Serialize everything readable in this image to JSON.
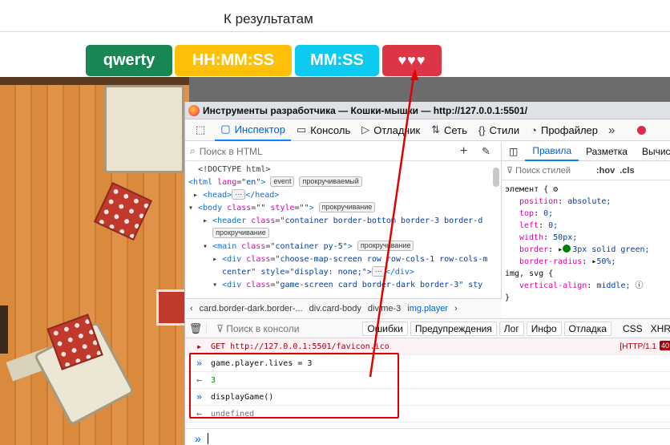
{
  "top_link": "К результатам",
  "badges": {
    "name": "qwerty",
    "time": "HH:MM:SS",
    "short_time": "MM:SS",
    "lives": "♥♥♥"
  },
  "devtools": {
    "window_title": "Инструменты разработчика — Кошки-мышки — http://127.0.0.1:5501/",
    "tabs": [
      "Инспектор",
      "Консоль",
      "Отладчик",
      "Сеть",
      "Стили",
      "Профайлер"
    ],
    "active_tab": "Инспектор",
    "html_search_placeholder": "Поиск в HTML",
    "tree": {
      "doctype": "<!DOCTYPE html>",
      "badge_event": "event",
      "badge_scroll": "прокручиваемый",
      "badge_scroll2": "прокручивание",
      "header_class": "container border-bottom border-3 border-d",
      "main_class": "container py-5",
      "div1_class": "choose-map-screen row row-cols-1 row-cols-m",
      "div1_cont": "center\" style=\"display: none;\">",
      "div2_class": "game-screen card border-dark border-3\" sty"
    },
    "breadcrumbs": [
      "card.border-dark.border-...",
      "div.card-body",
      "div.me-3",
      "img.player"
    ],
    "rules_tabs": [
      "Правила",
      "Разметка",
      "Вычис"
    ],
    "styles_filter_placeholder": "Поиск стилей",
    "hov": ":hov",
    "cls": ".cls",
    "rules": {
      "element_selector": "элемент {",
      "decls": [
        {
          "prop": "position",
          "val": "absolute;"
        },
        {
          "prop": "top",
          "val": "0;"
        },
        {
          "prop": "left",
          "val": "0;"
        },
        {
          "prop": "width",
          "val": "50px;"
        },
        {
          "prop": "border",
          "val": "3px solid green;"
        },
        {
          "prop": "border-radius",
          "val": "50%;"
        }
      ],
      "second_selector": "img, svg {",
      "second_decl_prop": "vertical-align",
      "second_decl_val": "middle;",
      "close": "}"
    },
    "console": {
      "filter_placeholder": "Поиск в консоли",
      "filters": [
        "Ошибки",
        "Предупреждения",
        "Лог",
        "Инфо",
        "Отладка"
      ],
      "opt_css": "CSS",
      "opt_xhr": "XHR",
      "get_line": "GET http://127.0.0.1:5501/favicon.ico",
      "http_status": "[HTTP/1.1",
      "http_code": "40",
      "input1": "game.player.lives = 3",
      "output1": "3",
      "input2": "displayGame()",
      "output2": "undefined"
    }
  }
}
